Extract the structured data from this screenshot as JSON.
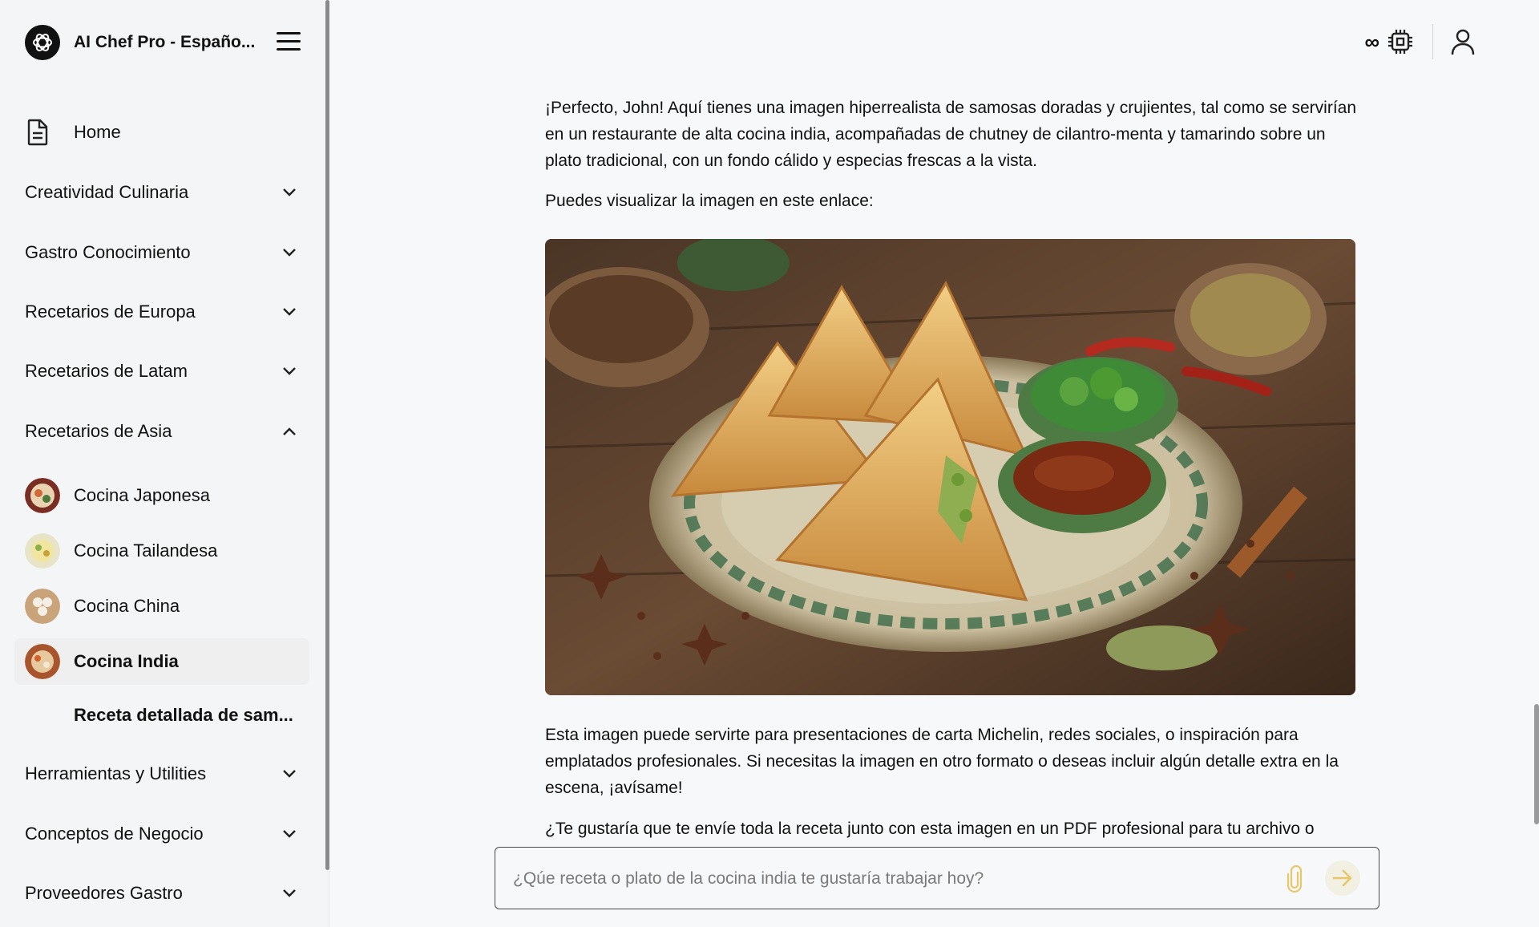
{
  "app": {
    "title": "AI Chef Pro - Españo..."
  },
  "sidebar": {
    "home_label": "Home",
    "sections": [
      {
        "label": "Creatividad Culinaria",
        "expanded": false
      },
      {
        "label": "Gastro Conocimiento",
        "expanded": false
      },
      {
        "label": "Recetarios de Europa",
        "expanded": false
      },
      {
        "label": "Recetarios de Latam",
        "expanded": false
      },
      {
        "label": "Recetarios de Asia",
        "expanded": true
      },
      {
        "label": "Herramientas y Utilities",
        "expanded": false
      },
      {
        "label": "Conceptos de Negocio",
        "expanded": false
      },
      {
        "label": "Proveedores Gastro",
        "expanded": false
      }
    ],
    "asia_items": [
      {
        "label": "Cocina Japonesa"
      },
      {
        "label": "Cocina Tailandesa"
      },
      {
        "label": "Cocina China"
      },
      {
        "label": "Cocina India",
        "active": true
      }
    ],
    "active_chat": "Receta detallada de sam..."
  },
  "topbar": {
    "infinity_symbol": "∞"
  },
  "chat": {
    "p1": "¡Perfecto, John! Aquí tienes una imagen hiperrealista de samosas doradas y crujientes, tal como se servirían en un restaurante de alta cocina india, acompañadas de chutney de cilantro-menta y tamarindo sobre un plato tradicional, con un fondo cálido y especias frescas a la vista.",
    "p2": "Puedes visualizar la imagen en este enlace:",
    "p3": "Esta imagen puede servirte para presentaciones de carta Michelin, redes sociales, o inspiración para emplatados profesionales. Si necesitas la imagen en otro formato o deseas incluir algún detalle extra en la escena, ¡avísame!",
    "p4": "¿Te gustaría que te envíe toda la receta junto con esta imagen en un PDF profesional para tu archivo o"
  },
  "composer": {
    "placeholder": "¿Qúe receta o plato de la cocina india te gustaría trabajar hoy?"
  },
  "colors": {
    "accent": "#e8c76a",
    "sidebar_bg": "#f4f5f7",
    "main_bg": "#f7f8fa"
  }
}
